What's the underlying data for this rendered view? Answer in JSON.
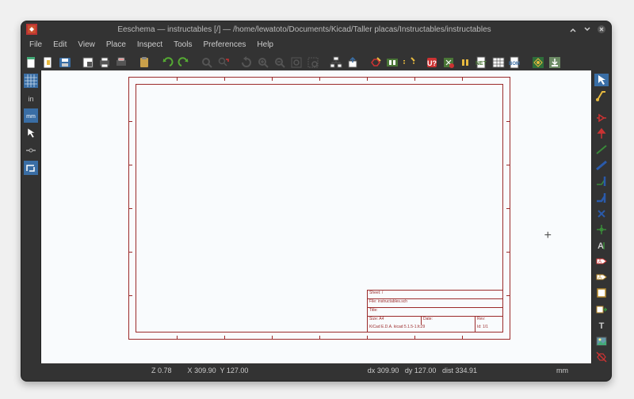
{
  "title": "Eeschema — instructables [/] — /home/lewatoto/Documents/Kicad/Taller placas/Instructables/instructables",
  "menu": {
    "file": "File",
    "edit": "Edit",
    "view": "View",
    "place": "Place",
    "inspect": "Inspect",
    "tools": "Tools",
    "preferences": "Preferences",
    "help": "Help"
  },
  "toolbar": {
    "new": "New Schematic",
    "open": "Open Schematic",
    "save": "Save Schematic",
    "page": "Page Settings",
    "print": "Print",
    "plot": "Plot",
    "paste": "Paste",
    "undo": "Undo",
    "redo": "Redo",
    "find": "Find",
    "replace": "Find and Replace",
    "refresh": "Refresh",
    "zoomin": "Zoom In",
    "zoomout": "Zoom Out",
    "zoomfit": "Zoom to Fit",
    "zoomsel": "Zoom to Selection",
    "navigate_up": "Leave Sheet",
    "navigate": "Navigate Hierarchy",
    "symeditor": "Symbol Editor",
    "browse": "Browse Symbol Libraries",
    "fpeditor": "Footprint Editor",
    "annotate": "Annotate Schematic",
    "erc": "Electrical Rules Check",
    "cvpcb": "Assign Footprints",
    "netlist": "Generate Netlist",
    "fields": "Edit Symbol Fields",
    "bom": "Generate BOM",
    "pcb": "Run Pcbnew",
    "import": "Import Footprint Assignments"
  },
  "lefttool": {
    "grid": "Show Grid",
    "units_in": "Inches",
    "units_mm": "Millimeters",
    "cursor": "Full Crosshair Cursor",
    "hidden_pins": "Show Hidden Pins",
    "bus_direction": "Force H/V Wires"
  },
  "righttool": {
    "select": "Select Items",
    "highlight": "Highlight Net",
    "place_symbol": "Place Symbol",
    "place_power": "Place Power Port",
    "wire": "Place Wire",
    "bus": "Place Bus",
    "wire2bus": "Wire to Bus Entry",
    "bus2bus": "Bus to Bus Entry",
    "noconnect": "Place No Connect",
    "junction": "Place Junction",
    "label": "Place Net Label",
    "glabel": "Place Global Label",
    "hlabel": "Place Hierarchical Label",
    "sheet": "Place Hierarchical Sheet",
    "importpin": "Import Hierarchical Pin",
    "text": "Place Text",
    "image": "Place Image",
    "delete": "Delete Items"
  },
  "titleblock": {
    "sheet": "Sheet: /",
    "file": "File: instructables.sch",
    "title": "Title:",
    "size_label": "Size: A4",
    "date": "Date:",
    "rev": "Rev:",
    "kicad": "KiCad E.D.A.  kicad 5.1.5-1.fc29",
    "id": "Id: 1/1"
  },
  "status": {
    "zoom_label": "Z",
    "zoom": "0.78",
    "x_label": "X",
    "x": "309.90",
    "y_label": "Y",
    "y": "127.00",
    "dx_label": "dx",
    "dx": "309.90",
    "dy_label": "dy",
    "dy": "127.00",
    "dist_label": "dist",
    "dist": "334.91",
    "units": "mm"
  }
}
